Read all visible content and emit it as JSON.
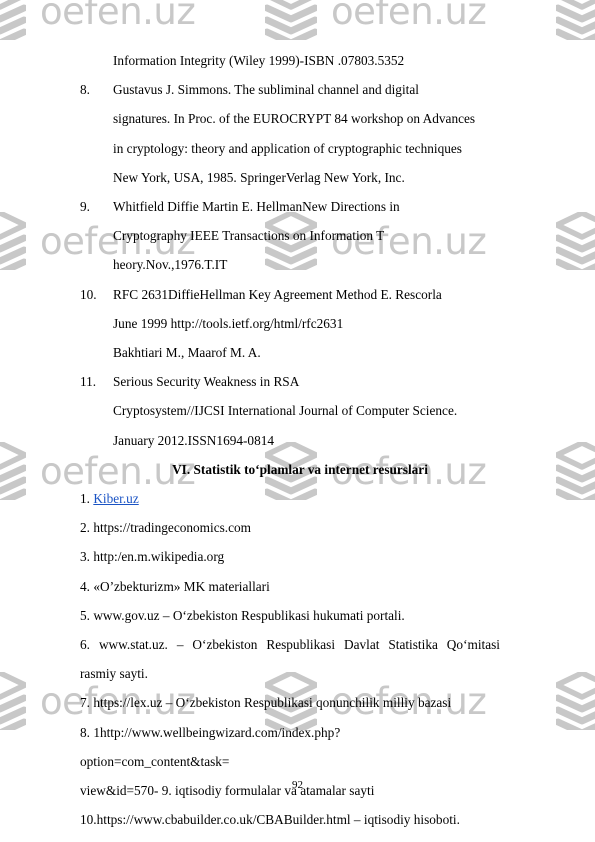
{
  "document": {
    "page_number": "92",
    "link_color": "#1a53c4",
    "watermark": {
      "text": "oefen.uz",
      "icon": "stacked-layers-icon",
      "color": "#c8c8c8"
    }
  },
  "references": {
    "orphan_line": "Information Integrity (Wiley 1999)-ISBN .07803.5352",
    "items": [
      {
        "number": "8.",
        "lines": [
          "Gustavus  J.  Simmons.  The  subliminal   channel  and  digital",
          "signatures. In Proc. of the EUROCRYPT 84 workshop on Advances",
          "in  cryptology:  theory  and  application  of  cryptographic  techniques",
          "New York, USA, 1985. SpringerVerlag New York, Inc."
        ]
      },
      {
        "number": "9.",
        "lines": [
          "Whitfield    Diffie Martin    E.    HellmanNew   Directions    in",
          "Cryptography IEEE  Transactions  on  Information  T",
          "heory.Nov.,1976.T.IT"
        ]
      },
      {
        "number": "10.",
        "lines": [
          "RFC  2631DiffieHellman  Key  Agreement  Method  E.  Rescorla",
          "June 1999 http://tools.ietf.org/html/rfc2631",
          "Bakhtiari  M.,  Maarof  M.  A."
        ]
      },
      {
        "number": "11.",
        "lines": [
          "Serious  Security  Weakness  in  RSA",
          "Cryptosystem//IJCSI International Journal of Computer Science.",
          "January 2012.ISSN1694-0814"
        ]
      }
    ]
  },
  "resources_section": {
    "title": "VI. Statistik to‘plamlar va internet resurslari",
    "items": [
      {
        "number": "1.",
        "text": "",
        "link_text": "Kiber.uz",
        "is_link": true
      },
      {
        "number": "2.",
        "text": "https://tradingeconomics.com",
        "is_link": false
      },
      {
        "number": "3.",
        "text": "http:/en.m.wikipedia.org",
        "is_link": false
      },
      {
        "number": "4.",
        "text": "«O’zbekturizm» MK materiallari",
        "is_link": false
      },
      {
        "number": "5.",
        "text": "www.gov.uz – O‘zbekiston Respublikasi hukumati portali.",
        "is_link": false
      },
      {
        "number": "6.",
        "text": "www.stat.uz.  –  O‘zbekiston  Respublikasi  Davlat  Statistika  Qo‘mitasi rasmiy sayti.",
        "is_link": false,
        "justify": true
      },
      {
        "number": "7.",
        "text": "https://lex.uz – O‘zbekiston Respublikasi qonunchilik milliy bazasi",
        "is_link": false
      },
      {
        "number": "8.",
        "text": "1http://www.wellbeingwizard.com/index.php?",
        "is_link": false
      }
    ],
    "continuation_lines": [
      "option=com_content&task=",
      "view&id=570- 9. iqtisodiy formulalar va atamalar sayti"
    ],
    "last_item": {
      "number": "10.",
      "text": "https://www.cbabuilder.co.uk/CBABuilder.html – iqtisodiy hisoboti."
    }
  }
}
